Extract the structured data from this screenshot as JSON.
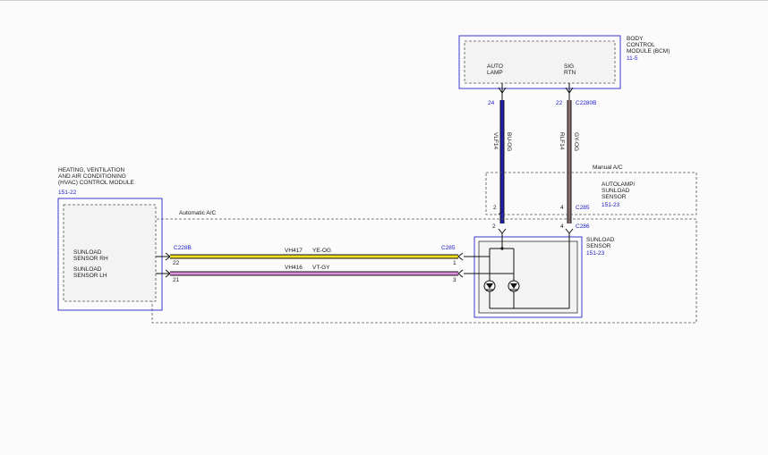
{
  "bcm": {
    "title": [
      "BODY",
      "CONTROL",
      "MODULE (BCM)"
    ],
    "ref": "11-5",
    "pin_auto_lamp": [
      "AUTO",
      "LAMP"
    ],
    "pin_sig_rtn": [
      "SIG",
      "RTN"
    ],
    "pin_24": "24",
    "pin_22": "22",
    "connector": "C2280B"
  },
  "wire_blue": {
    "circuit": "VLF14",
    "color": "BU-OG",
    "hex": "#1f1fb5"
  },
  "wire_brown": {
    "circuit": "RLF14",
    "color": "GY-OG",
    "hex": "#8a7070"
  },
  "manual_ac": {
    "label": "Manual A/C"
  },
  "autolamp_sensor": {
    "title": [
      "AUTOLAMP/",
      "SUNLOAD",
      "SENSOR"
    ],
    "ref": "151-23",
    "pin_2": "2",
    "pin_4": "4",
    "connector": "C285"
  },
  "sunload_sensor": {
    "title": [
      "SUNLOAD",
      "SENSOR"
    ],
    "ref": "151-23",
    "connector": "C286",
    "pin_2": "2",
    "pin_4": "4"
  },
  "automatic_ac": {
    "label": "Automatic A/C"
  },
  "hvac": {
    "title": [
      "HEATING, VENTILATION",
      "AND AIR CONDITIONING",
      "(HVAC) CONTROL MODULE"
    ],
    "ref": "151-22",
    "sensor_rh": [
      "SUNLOAD",
      "SENSOR RH"
    ],
    "sensor_lh": [
      "SUNLOAD",
      "SENSOR LH"
    ],
    "connector": "C228B",
    "pin_22": "22",
    "pin_21": "21"
  },
  "wire_yellow": {
    "circuit": "VH417",
    "color": "YE-OG",
    "hex": "#f0e020"
  },
  "wire_violet": {
    "circuit": "VH416",
    "color": "VT-GY",
    "hex": "#e090e0"
  },
  "sensor_side": {
    "connector": "C285",
    "pin_1": "1",
    "pin_3": "3"
  }
}
